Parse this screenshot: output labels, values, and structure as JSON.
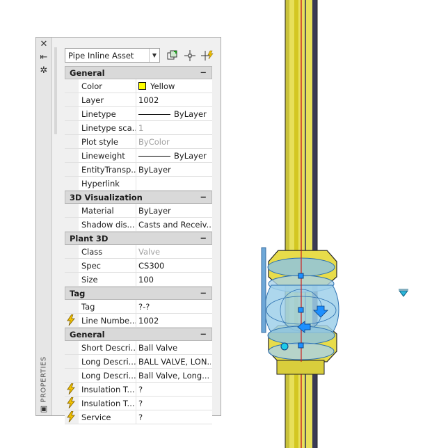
{
  "palette": {
    "vertical_title": "PROPERTIES",
    "object_select": "Pipe Inline Asset",
    "strip_icons": [
      "close-icon",
      "auto-hide-icon",
      "properties-settings-icon"
    ],
    "categories": [
      {
        "label": "General",
        "toggle": "−",
        "rows": [
          {
            "name": "Color",
            "value": "Yellow",
            "swatch": "#ffff00"
          },
          {
            "name": "Layer",
            "value": "1002"
          },
          {
            "name": "Linetype",
            "value": "ByLayer",
            "line": true
          },
          {
            "name": "Linetype sca...",
            "value": "1",
            "dim": true
          },
          {
            "name": "Plot style",
            "value": "ByColor",
            "dim": true
          },
          {
            "name": "Lineweight",
            "value": "ByLayer",
            "line": true
          },
          {
            "name": "EntityTransp...",
            "value": "ByLayer"
          },
          {
            "name": "Hyperlink",
            "value": ""
          }
        ]
      },
      {
        "label": "3D Visualization",
        "toggle": "−",
        "rows": [
          {
            "name": "Material",
            "value": "ByLayer"
          },
          {
            "name": "Shadow dis...",
            "value": "Casts and Receiv..."
          }
        ]
      },
      {
        "label": "Plant 3D",
        "toggle": "−",
        "rows": [
          {
            "name": "Class",
            "value": "Valve",
            "dim": true
          },
          {
            "name": "Spec",
            "value": "CS300"
          },
          {
            "name": "Size",
            "value": "100"
          }
        ]
      },
      {
        "label": "Tag",
        "toggle": "−",
        "rows": [
          {
            "name": "Tag",
            "value": "?-?"
          },
          {
            "name": "Line Numbe...",
            "value": "1002",
            "bolt": true
          }
        ]
      },
      {
        "label": "General",
        "toggle": "−",
        "rows": [
          {
            "name": "Short Descri...",
            "value": "Ball Valve"
          },
          {
            "name": "Long Descri...",
            "value": "BALL VALVE, LON..."
          },
          {
            "name": "Long Descri...",
            "value": "Ball Valve, Long..."
          },
          {
            "name": "Insulation T...",
            "value": "?",
            "bolt": true
          },
          {
            "name": "Insulation T...",
            "value": "?",
            "bolt": true
          },
          {
            "name": "Service",
            "value": "?",
            "bolt": true
          }
        ]
      }
    ]
  },
  "colors": {
    "pipe_yellow": "#e7e05a",
    "pipe_dark": "#2d2d32",
    "pipe_highlight": "#d4c820",
    "centerline": "#cc2020",
    "grip_blue": "#1e90ff",
    "valve_cyan": "#7fc8e8"
  }
}
